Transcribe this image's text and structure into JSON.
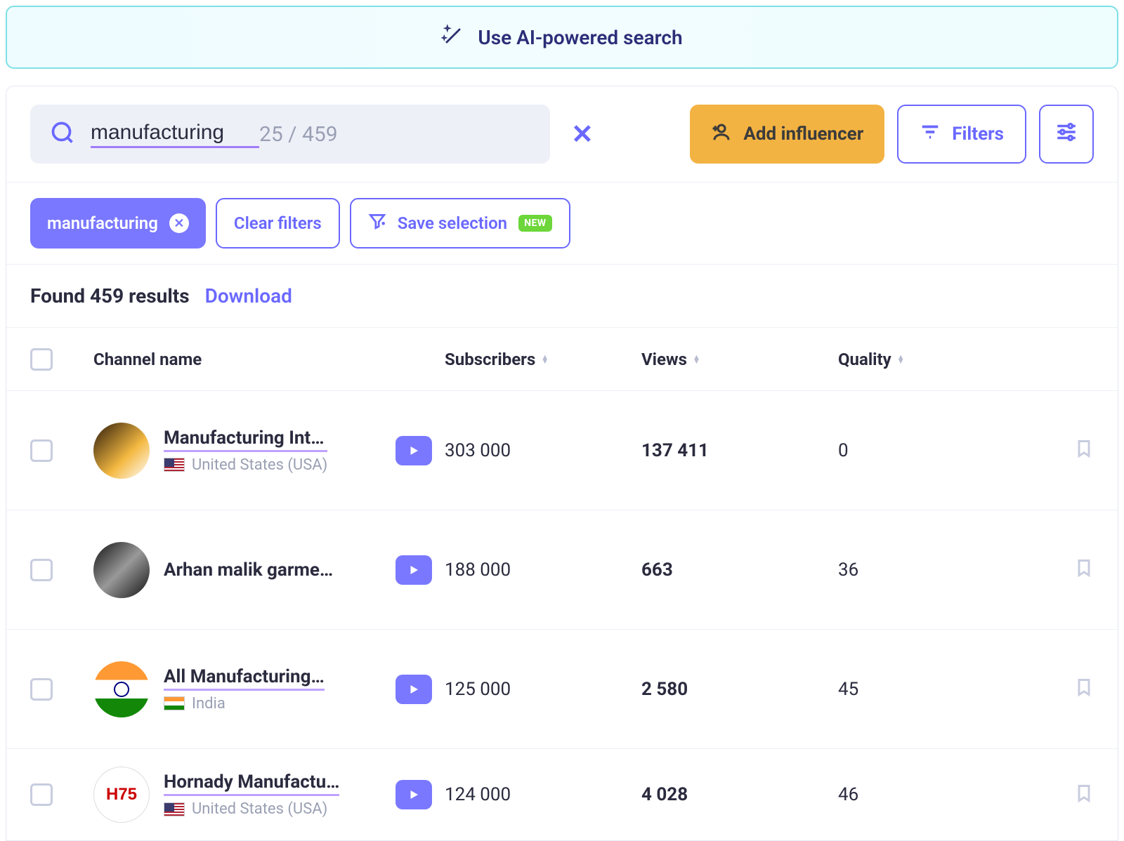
{
  "ai_banner": {
    "label": "Use AI-powered search"
  },
  "search": {
    "query": "manufacturing",
    "count": "25 / 459"
  },
  "toolbar": {
    "add_label": "Add influencer",
    "filters_label": "Filters"
  },
  "chips": {
    "filter_tag": "manufacturing",
    "clear": "Clear filters",
    "save": "Save selection",
    "new_badge": "NEW"
  },
  "results": {
    "found": "Found 459 results",
    "download": "Download"
  },
  "columns": {
    "name": "Channel name",
    "subs": "Subscribers",
    "views": "Views",
    "quality": "Quality"
  },
  "rows": [
    {
      "name": "Manufacturing Int…",
      "country": "United States (USA)",
      "flag": "us",
      "subs": "303 000",
      "views": "137 411",
      "quality": "0",
      "av": "av1",
      "hl": true
    },
    {
      "name": "Arhan malik garme…",
      "country": "",
      "flag": "",
      "subs": "188 000",
      "views": "663",
      "quality": "36",
      "av": "av2",
      "hl": false
    },
    {
      "name": "All Manufacturing…",
      "country": "India",
      "flag": "in",
      "subs": "125 000",
      "views": "2 580",
      "quality": "45",
      "av": "av3",
      "hl": true
    },
    {
      "name": "Hornady Manufactu…",
      "country": "United States (USA)",
      "flag": "us",
      "subs": "124 000",
      "views": "4 028",
      "quality": "46",
      "av": "av4",
      "hl": true
    }
  ]
}
